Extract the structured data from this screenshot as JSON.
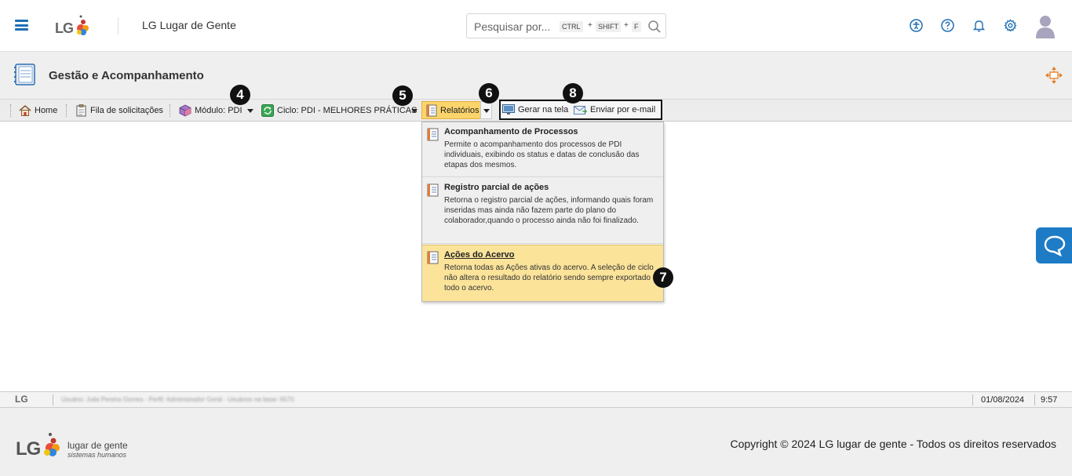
{
  "header": {
    "logo_text": "LG",
    "app_title": "LG Lugar de Gente",
    "search": {
      "placeholder": "Pesquisar por...",
      "keys": [
        "CTRL",
        "SHIFT",
        "F"
      ],
      "plus": "+"
    },
    "icons": [
      "accessibility-icon",
      "help-icon",
      "bell-icon",
      "gear-icon"
    ],
    "accent_color": "#1e6fb5"
  },
  "page": {
    "title": "Gestão e Acompanhamento"
  },
  "toolbar": {
    "home": "Home",
    "queue": "Fila de solicitações",
    "module": "Módulo: PDI",
    "cycle": "Ciclo: PDI - MELHORES PRÁTICAS",
    "reports": "Relatórios",
    "generate": "Gerar na tela",
    "email": "Enviar por e-mail"
  },
  "badges": {
    "b4": "4",
    "b5": "5",
    "b6": "6",
    "b7": "7",
    "b8": "8"
  },
  "reports_menu": {
    "items": [
      {
        "title": "Acompanhamento de Processos",
        "desc": "Permite o acompanhamento dos processos de PDI individuais, exibindo os status e datas de conclusão das etapas dos mesmos."
      },
      {
        "title": "Registro parcial de ações",
        "desc": "Retorna o registro parcial de ações, informando quais foram inseridas mas ainda não fazem parte do plano do colaborador,quando o processo ainda não foi finalizado."
      },
      {
        "title": "Ações do Acervo",
        "desc": "Retorna todas as Ações ativas do acervo. A seleção de ciclo não altera o resultado do relatório sendo sempre exportado todo o acervo."
      }
    ],
    "highlight_color": "#fbe39a"
  },
  "statusbar": {
    "logo": "LG",
    "info": "Usuário: Julia Pereira Gomes - Perfil: Administrador Geral - Usuários na base: 6570",
    "date": "01/08/2024",
    "time": "9:57"
  },
  "footer": {
    "logo": "LG",
    "name": "lugar de gente",
    "subtitle": "sistemas humanos",
    "copyright": "Copyright © 2024 LG lugar de gente - Todos os direitos reservados"
  }
}
